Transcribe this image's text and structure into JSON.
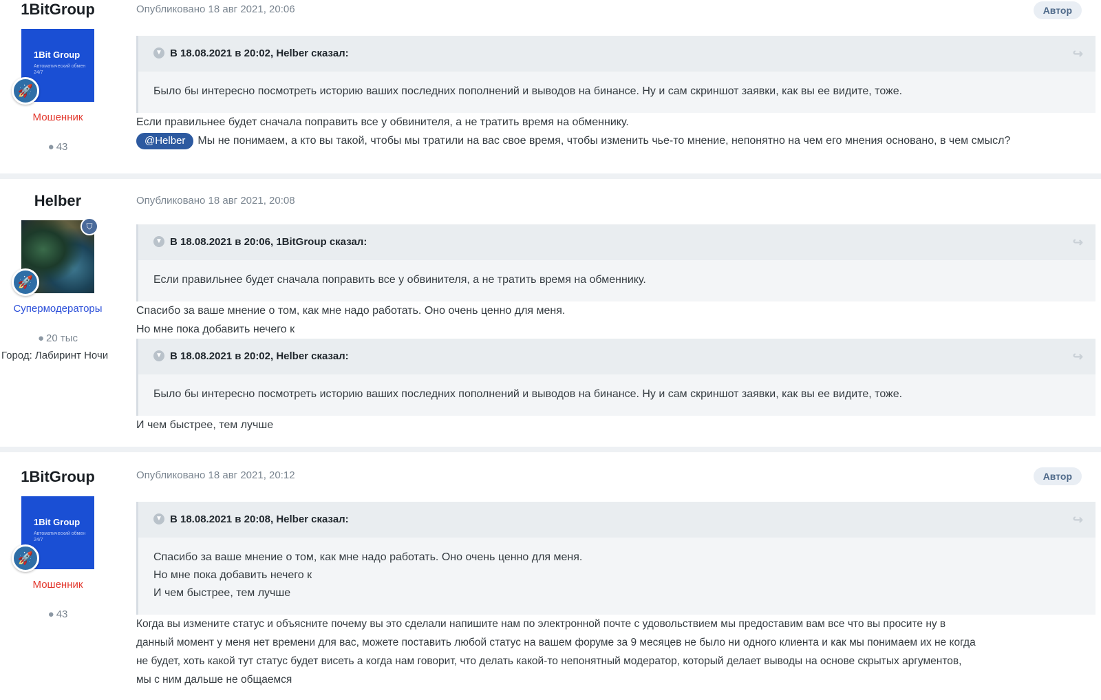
{
  "posts": [
    {
      "author": "1BitGroup",
      "avatar_brand": "1Bit Group",
      "avatar_tagline": "Автоматический обмен 24/7",
      "group": "Мошенник",
      "post_count": "43",
      "published": "Опубликовано 18 авг 2021, 20:06",
      "badge": "Автор",
      "quotes": [
        {
          "header": "В 18.08.2021 в 20:02, Helber сказал:",
          "body": [
            "Было бы интересно посмотреть историю ваших последних пополнений и выводов на бинансе. Ну и сам скриншот заявки, как вы ее видите, тоже."
          ]
        }
      ],
      "text_1": "Если правильнее будет сначала поправить все у обвинителя, а не тратить время на обменнику.",
      "mention": "@Helber",
      "text_2": "Мы не понимаем, а кто вы такой, чтобы мы тратили на вас свое время, чтобы изменить чье-то мнение, непонятно на чем его мнения основано, в чем смысл?"
    },
    {
      "author": "Helber",
      "group": "Супермодераторы",
      "post_count": "20 тыс",
      "city": "Город: Лабиринт Ночи",
      "published": "Опубликовано 18 авг 2021, 20:08",
      "quote_1": {
        "header": "В 18.08.2021 в 20:06, 1BitGroup сказал:",
        "body": "Если правильнее будет сначала поправить все у обвинителя, а не тратить время на обменнику."
      },
      "text_1": "Спасибо за ваше мнение о том, как мне надо работать. Оно очень ценно для меня.",
      "text_2": "Но мне пока добавить нечего к",
      "quote_2": {
        "header": "В 18.08.2021 в 20:02, Helber сказал:",
        "body": "Было бы интересно посмотреть историю ваших последних пополнений и выводов на бинансе. Ну и сам скриншот заявки, как вы ее видите, тоже."
      },
      "text_3": "И чем быстрее, тем лучше"
    },
    {
      "author": "1BitGroup",
      "avatar_brand": "1Bit Group",
      "avatar_tagline": "Автоматический обмен 24/7",
      "group": "Мошенник",
      "post_count": "43",
      "published": "Опубликовано 18 авг 2021, 20:12",
      "badge": "Автор",
      "quote": {
        "header": "В 18.08.2021 в 20:08, Helber сказал:",
        "lines": [
          "Спасибо за ваше мнение о том, как мне надо работать. Оно очень ценно для меня.",
          "Но мне пока добавить нечего к",
          "И чем быстрее, тем лучше"
        ]
      },
      "text_lines": [
        "Когда вы измените статус и объясните почему вы это сделали напишите нам по электронной почте с удовольствием мы предоставим вам все что вы просите ну в",
        "данный момент у меня нет времени для вас, можете поставить любой статус на вашем форуме за 9 месяцев не было ни одного клиента и как мы понимаем их не когда",
        "не будет, хоть какой тут статус будет висеть а когда нам говорит, что делать какой-то непонятный модератор, который делает выводы на основе скрытых аргументов,",
        "мы с ним дальше не общаемся"
      ]
    }
  ],
  "icons": {
    "rocket": "rocket-icon",
    "shield": "shield-icon",
    "comment": "comment-icon",
    "share": "share-icon",
    "chevron": "chevron-down-icon"
  },
  "colors": {
    "fraud_group": "#e2352b",
    "moderator_group": "#2b4fd9",
    "avatar_blue": "#1a4fd4",
    "mention_bg": "#2d5aa0"
  }
}
